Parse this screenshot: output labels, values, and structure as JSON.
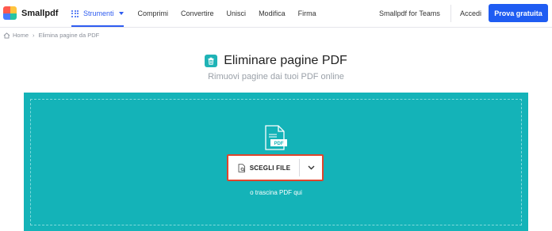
{
  "brand": {
    "name": "Smallpdf"
  },
  "nav": {
    "tools_label": "Strumenti",
    "items": [
      "Comprimi",
      "Convertire",
      "Unisci",
      "Modifica",
      "Firma"
    ],
    "teams_label": "Smallpdf for Teams",
    "login_label": "Accedi",
    "cta_label": "Prova gratuita"
  },
  "breadcrumb": {
    "home": "Home",
    "current": "Elimina pagine da PDF"
  },
  "page": {
    "title": "Eliminare pagine PDF",
    "subtitle": "Rimuovi pagine dai tuoi PDF online"
  },
  "dropzone": {
    "choose_label": "SCEGLI FILE",
    "hint": "o trascina PDF qui",
    "file_icon_label": "PDF"
  },
  "colors": {
    "accent_blue": "#1f5cf2",
    "teal": "#14b3b8",
    "highlight_red": "#e0452c"
  }
}
